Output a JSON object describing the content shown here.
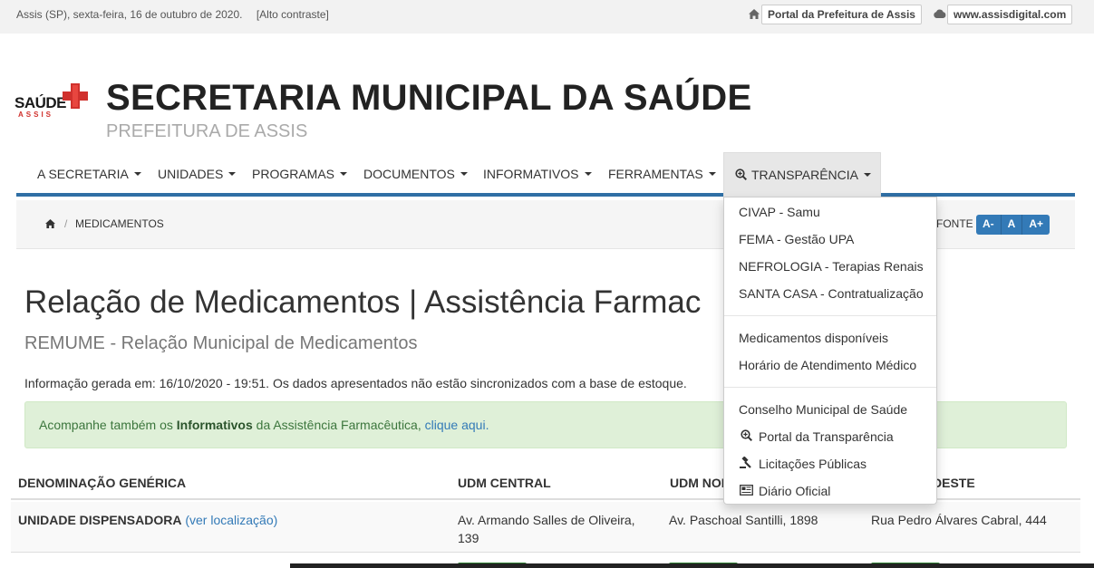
{
  "topbar": {
    "date_text": "Assis (SP), sexta-feira, 16 de outubro de 2020.",
    "contrast_link": "[Alto contraste]",
    "prefeitura_link": "Portal da Prefeitura de Assis",
    "digital_link": "www.assisdigital.com"
  },
  "logo": {
    "saude": "SAÚDE",
    "assis": "ASSIS"
  },
  "header": {
    "title": "SECRETARIA MUNICIPAL DA SAÚDE",
    "subtitle": "PREFEITURA DE ASSIS"
  },
  "nav": {
    "items": [
      {
        "label": "A SECRETARIA"
      },
      {
        "label": "UNIDADES"
      },
      {
        "label": "PROGRAMAS"
      },
      {
        "label": "DOCUMENTOS"
      },
      {
        "label": "INFORMATIVOS"
      },
      {
        "label": "FERRAMENTAS"
      },
      {
        "label": "TRANSPARÊNCIA"
      }
    ]
  },
  "breadcrumb": {
    "separator": "/",
    "current": "MEDICAMENTOS"
  },
  "font_controls": {
    "label": "FONTE",
    "decrease": "A-",
    "normal": "A",
    "increase": "A+"
  },
  "page": {
    "title": "Relação de Medicamentos | Assistência Farmac",
    "subtitle": "REMUME - Relação Municipal de Medicamentos",
    "info": "Informação gerada em: 16/10/2020 - 19:51. Os dados apresentados não estão sincronizados com a base de estoque.",
    "alert": {
      "prefix": "Acompanhe também os ",
      "bold": "Informativos",
      "middle": " da Assistência Farmacêutica, ",
      "link": "clique aqui."
    }
  },
  "table": {
    "headers": [
      "DENOMINAÇÃO GENÉRICA",
      "UDM CENTRAL",
      "UDM NOR",
      "DESTE"
    ],
    "row": {
      "label": "UNIDADE DISPENSADORA",
      "link": "(ver localização)",
      "central": "Av. Armando Salles de Oliveira, 139",
      "norte": "Av. Paschoal Santilli, 1898",
      "leste": "Rua Pedro Álvares Cabral, 444"
    }
  },
  "dropdown": {
    "group1": [
      "CIVAP - Samu",
      "FEMA - Gestão UPA",
      "NEFROLOGIA - Terapias Renais",
      "SANTA CASA - Contratualização"
    ],
    "group2": [
      "Medicamentos disponíveis",
      "Horário de Atendimento Médico"
    ],
    "group3": [
      {
        "label": "Conselho Municipal de Saúde",
        "icon": ""
      },
      {
        "label": "Portal da Transparência",
        "icon": "search-plus-icon"
      },
      {
        "label": "Licitações Públicas",
        "icon": "gavel-icon"
      },
      {
        "label": "Diário Oficial",
        "icon": "newspaper-icon"
      }
    ]
  },
  "colors": {
    "nav_border": "#2f6fa5",
    "link": "#337ab7",
    "alert_bg": "#dff0d8",
    "accent_red": "#d0312d"
  }
}
